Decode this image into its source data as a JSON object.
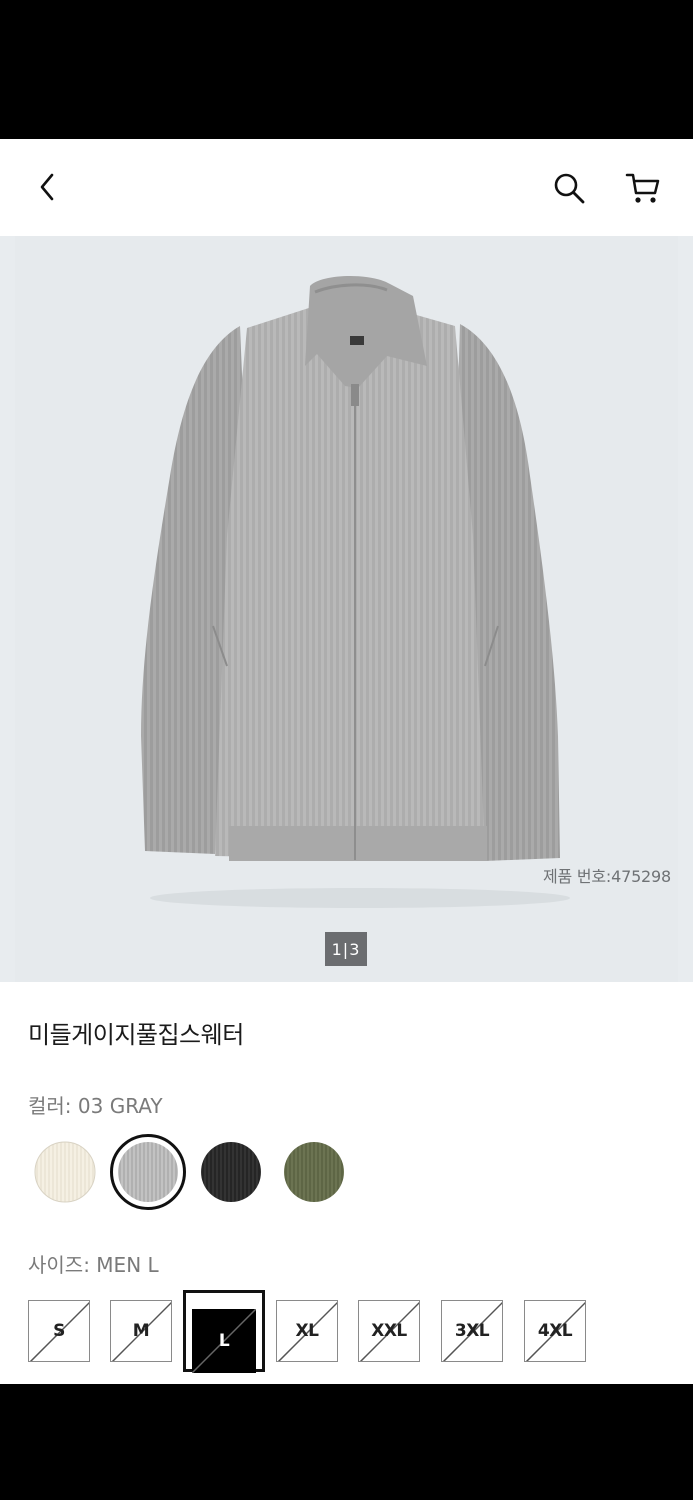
{
  "header": {
    "back_icon": "chevron-left-icon",
    "search_icon": "search-icon",
    "cart_icon": "cart-icon"
  },
  "gallery": {
    "product_code": "제품 번호:475298",
    "pager_current": "1",
    "pager_total": "3"
  },
  "product": {
    "name": "미들게이지풀집스웨터"
  },
  "color": {
    "label": "컬러: 03 GRAY",
    "swatches": [
      {
        "name": "ivory",
        "color": "#ece6d7"
      },
      {
        "name": "gray",
        "color": "#b5b5b5",
        "selected": true
      },
      {
        "name": "black",
        "color": "#2a2a2a"
      },
      {
        "name": "olive",
        "color": "#646c4b"
      }
    ]
  },
  "size": {
    "label": "사이즈: MEN L",
    "options": [
      {
        "label": "S",
        "selected": false,
        "unavailable": true
      },
      {
        "label": "M",
        "selected": false,
        "unavailable": true
      },
      {
        "label": "L",
        "selected": true,
        "unavailable": true
      },
      {
        "label": "XL",
        "selected": false,
        "unavailable": true
      },
      {
        "label": "XXL",
        "selected": false,
        "unavailable": true
      },
      {
        "label": "3XL",
        "selected": false,
        "unavailable": true
      },
      {
        "label": "4XL",
        "selected": false,
        "unavailable": true
      }
    ]
  }
}
